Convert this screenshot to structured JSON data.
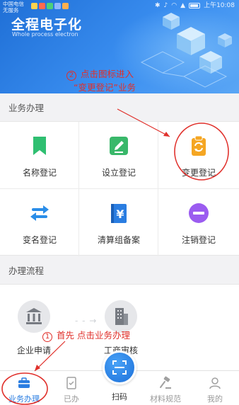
{
  "status_bar": {
    "carrier_line1": "中国电信",
    "carrier_line2": "无服务",
    "time": "上午10:08"
  },
  "header": {
    "title": "全程电子化",
    "subtitle": "Whole process electron"
  },
  "annotations": {
    "step2_number": "2",
    "step2_line1": "点击图标进入",
    "step2_line2": "“变更登记”业务",
    "step1_number": "1",
    "step1_text": "首先  点击业务办理"
  },
  "business": {
    "section_title": "业务办理",
    "items": [
      {
        "label": "名称登记",
        "icon": "bookmark-icon",
        "color": "#2fbf71"
      },
      {
        "label": "设立登记",
        "icon": "edit-icon",
        "color": "#39b86a"
      },
      {
        "label": "变更登记",
        "icon": "clipboard-refresh-icon",
        "color": "#f5a623"
      },
      {
        "label": "变名登记",
        "icon": "swap-arrows-icon",
        "color": "#2a8de8"
      },
      {
        "label": "清算组备案",
        "icon": "yen-book-icon",
        "color": "#2a7de1"
      },
      {
        "label": "注销登记",
        "icon": "minus-circle-icon",
        "color": "#9b5cf0"
      }
    ]
  },
  "process": {
    "section_title": "办理流程",
    "steps": [
      {
        "label": "企业申请",
        "icon": "bank-icon"
      },
      {
        "label": "工商审核",
        "icon": "building-icon"
      }
    ]
  },
  "tabbar": {
    "tabs": [
      {
        "label": "业务办理",
        "icon": "briefcase-icon",
        "active": true
      },
      {
        "label": "已办",
        "icon": "done-list-icon",
        "active": false
      },
      {
        "label": "扫码",
        "icon": "scan-icon",
        "active": false
      },
      {
        "label": "材料规范",
        "icon": "gavel-icon",
        "active": false
      },
      {
        "label": "我的",
        "icon": "user-icon",
        "active": false
      }
    ]
  },
  "colors": {
    "accent": "#2a7de1",
    "annotation": "#e0302b",
    "header_gradient_start": "#1f6fd6",
    "header_gradient_end": "#5aa6f5"
  }
}
